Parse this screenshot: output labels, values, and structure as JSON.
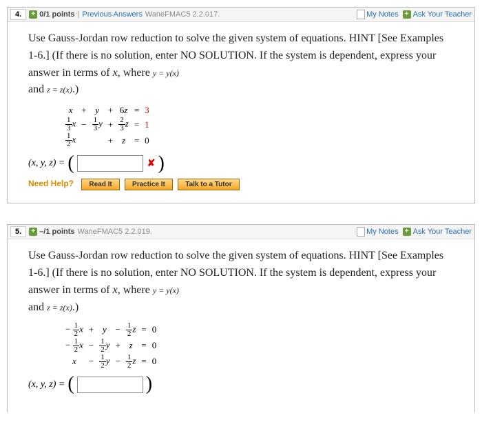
{
  "q4": {
    "number": "4.",
    "points": "0/1 points",
    "prev": "Previous Answers",
    "source": "WaneFMAC5 2.2.017.",
    "mynotes": "My Notes",
    "ask": "Ask Your Teacher",
    "instr_a": "Use Gauss-Jordan row reduction to solve the given system of equations. HINT [See Examples 1-6.] (If there is no solution, enter NO SOLUTION. If the system is dependent, express your answer in terms of ",
    "instr_x": "x",
    "instr_b": ", where ",
    "sub1": "y = y(x)",
    "instr_c": "and ",
    "sub2": "z = z(x)",
    "instr_d": ".)",
    "ans_label": "(x, y, z) = ",
    "need": "Need Help?",
    "read": "Read It",
    "practice": "Practice It",
    "tutor": "Talk to a Tutor",
    "system": {
      "rows": [
        {
          "c1": "x",
          "c1s": "+",
          "c2": "y",
          "c2s": "+",
          "c3": "6z",
          "eq": "=",
          "rhs": "3",
          "rhsred": true
        },
        {
          "c1": "f:1/3:x",
          "c1s": "−",
          "c2": "f:1/3:y",
          "c2s": "+",
          "c3": "f:2/3:z",
          "eq": "=",
          "rhs": "1",
          "rhsred": true
        },
        {
          "c1": "f:1/2:x",
          "c1s": "",
          "c2": "",
          "c2s": "+",
          "c3": "z",
          "eq": "=",
          "rhs": "0",
          "rhsred": false
        }
      ]
    }
  },
  "q5": {
    "number": "5.",
    "points": "–/1 points",
    "source": "WaneFMAC5 2.2.019.",
    "mynotes": "My Notes",
    "ask": "Ask Your Teacher",
    "instr_a": "Use Gauss-Jordan row reduction to solve the given system of equations. HINT [See Examples 1-6.] (If there is no solution, enter NO SOLUTION. If the system is dependent, express your answer in terms of ",
    "instr_x": "x",
    "instr_b": ", where ",
    "sub1": "y = y(x)",
    "instr_c": "and ",
    "sub2": "z = z(x)",
    "instr_d": ".)",
    "ans_label": "(x, y, z) = ",
    "system": {
      "rows": [
        {
          "c1": "− f:1/2:x",
          "c1s": "+",
          "c2": "y",
          "c2s": "−",
          "c3": "f:1/2:z",
          "eq": "=",
          "rhs": "0"
        },
        {
          "c1": "− f:1/2:x",
          "c1s": "−",
          "c2": "f:1/2:y",
          "c2s": "+",
          "c3": "z",
          "eq": "=",
          "rhs": "0"
        },
        {
          "c1": "x",
          "c1s": "−",
          "c2": "f:1/2:y",
          "c2s": "−",
          "c3": "f:1/2:z",
          "eq": "=",
          "rhs": "0"
        }
      ]
    }
  }
}
